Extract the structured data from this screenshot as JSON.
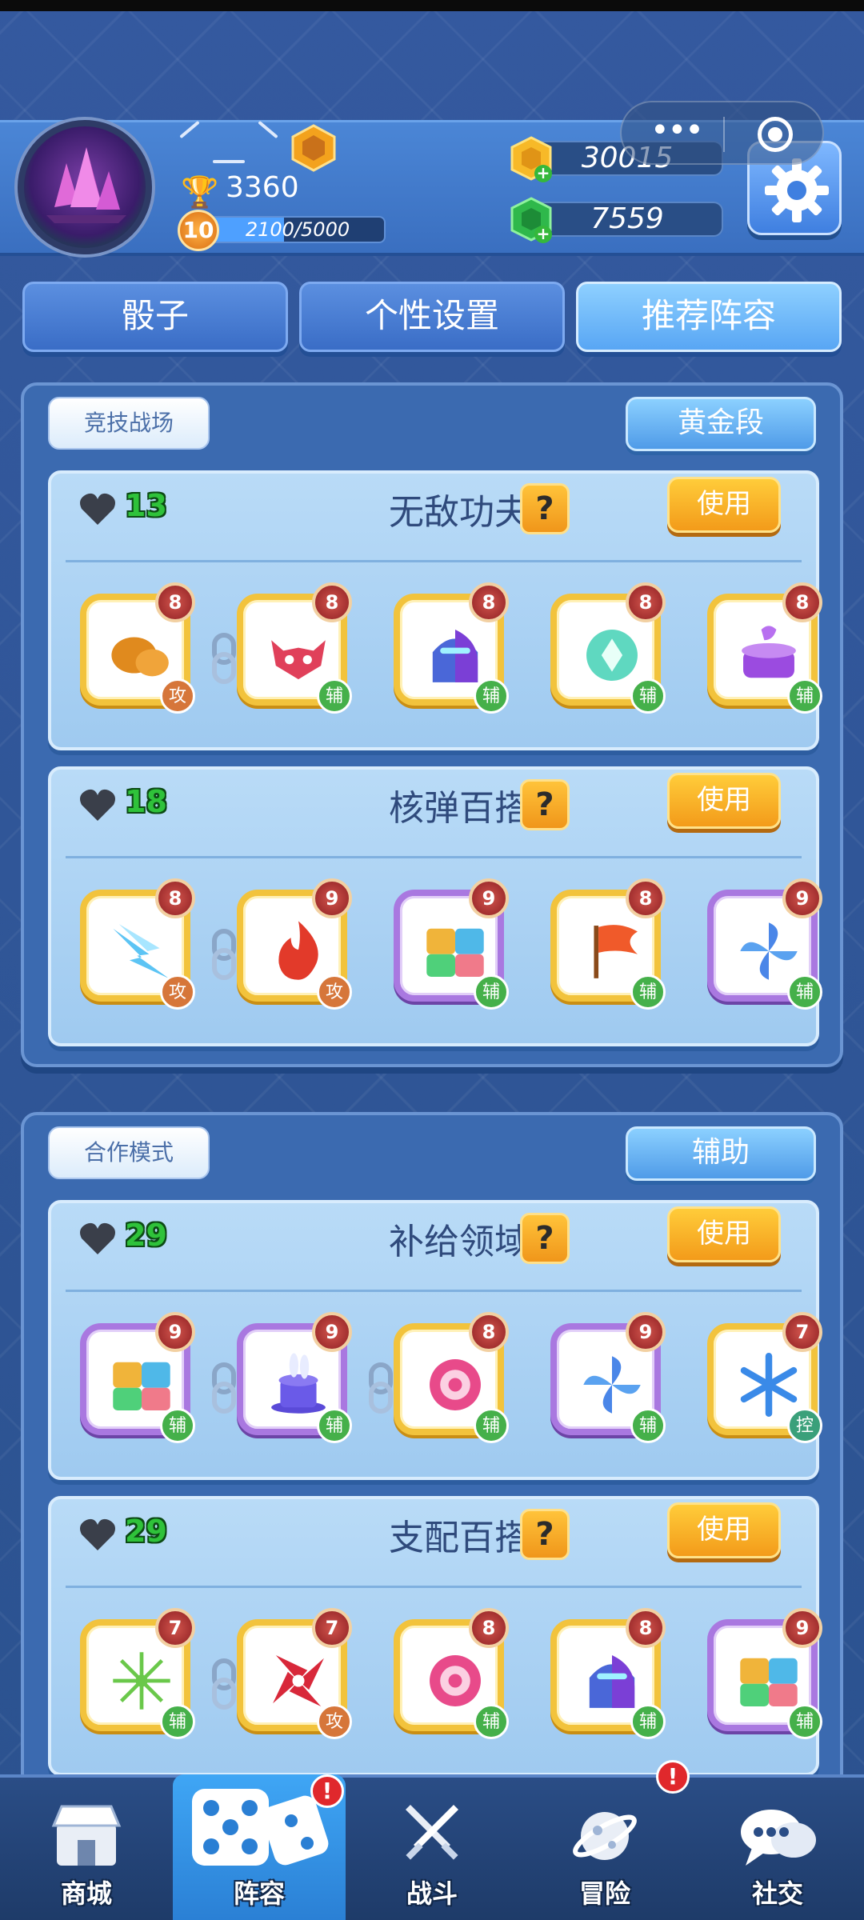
{
  "player": {
    "trophies": "3360",
    "level": "10",
    "xp_text": "2100/5000",
    "xp_progress": 0.42
  },
  "currency": {
    "gold": "30015",
    "gems": "7559"
  },
  "tabs": [
    {
      "label": "骰子",
      "active": false
    },
    {
      "label": "个性设置",
      "active": false
    },
    {
      "label": "推荐阵容",
      "active": true
    }
  ],
  "sections": [
    {
      "mode": "竞技战场",
      "tier": "黄金段",
      "decks": [
        {
          "count": "13",
          "title": "无敌功夫",
          "help": "?",
          "use": "使用",
          "dice": [
            {
              "level": "8",
              "role": "攻",
              "art": "bread-icon"
            },
            {
              "level": "8",
              "role": "辅",
              "art": "demon-icon"
            },
            {
              "level": "8",
              "role": "辅",
              "art": "knight-icon"
            },
            {
              "level": "8",
              "role": "辅",
              "art": "shield-gem-icon"
            },
            {
              "level": "8",
              "role": "辅",
              "art": "cauldron-icon"
            }
          ]
        },
        {
          "count": "18",
          "title": "核弹百搭",
          "help": "?",
          "use": "使用",
          "dice": [
            {
              "level": "8",
              "role": "攻",
              "art": "lightning-icon"
            },
            {
              "level": "9",
              "role": "攻",
              "art": "flame-icon"
            },
            {
              "level": "9",
              "role": "辅",
              "art": "puzzle-icon"
            },
            {
              "level": "8",
              "role": "辅",
              "art": "flag-icon"
            },
            {
              "level": "9",
              "role": "辅",
              "art": "pinwheel-icon"
            }
          ]
        }
      ]
    },
    {
      "mode": "合作模式",
      "tier": "辅助",
      "decks": [
        {
          "count": "29",
          "title": "补给领域",
          "help": "?",
          "use": "使用",
          "dice": [
            {
              "level": "9",
              "role": "辅",
              "art": "puzzle-icon"
            },
            {
              "level": "9",
              "role": "辅",
              "art": "magic-hat-icon"
            },
            {
              "level": "8",
              "role": "辅",
              "art": "eye-gear-icon"
            },
            {
              "level": "9",
              "role": "辅",
              "art": "pinwheel-icon"
            },
            {
              "level": "7",
              "role": "控",
              "art": "snowflake-icon"
            }
          ]
        },
        {
          "count": "29",
          "title": "支配百搭",
          "help": "?",
          "use": "使用",
          "dice": [
            {
              "level": "7",
              "role": "辅",
              "art": "dandelion-icon"
            },
            {
              "level": "7",
              "role": "攻",
              "art": "shuriken-icon"
            },
            {
              "level": "8",
              "role": "辅",
              "art": "eye-gear-icon"
            },
            {
              "level": "8",
              "role": "辅",
              "art": "knight-icon"
            },
            {
              "level": "9",
              "role": "辅",
              "art": "puzzle-icon"
            }
          ]
        }
      ]
    }
  ],
  "nav": [
    {
      "label": "商城",
      "icon": "shop-icon",
      "alert": ""
    },
    {
      "label": "阵容",
      "icon": "dice-icon",
      "alert": "!"
    },
    {
      "label": "战斗",
      "icon": "crossed-swords-icon",
      "alert": ""
    },
    {
      "label": "冒险",
      "icon": "planet-icon",
      "alert": "!"
    },
    {
      "label": "社交",
      "icon": "chat-icon",
      "alert": ""
    }
  ],
  "colors": {
    "gold_frame": "#f2c33c",
    "purple_frame": "#a978e0",
    "attack_role": "#d6763a",
    "support_role": "#45b04a"
  }
}
